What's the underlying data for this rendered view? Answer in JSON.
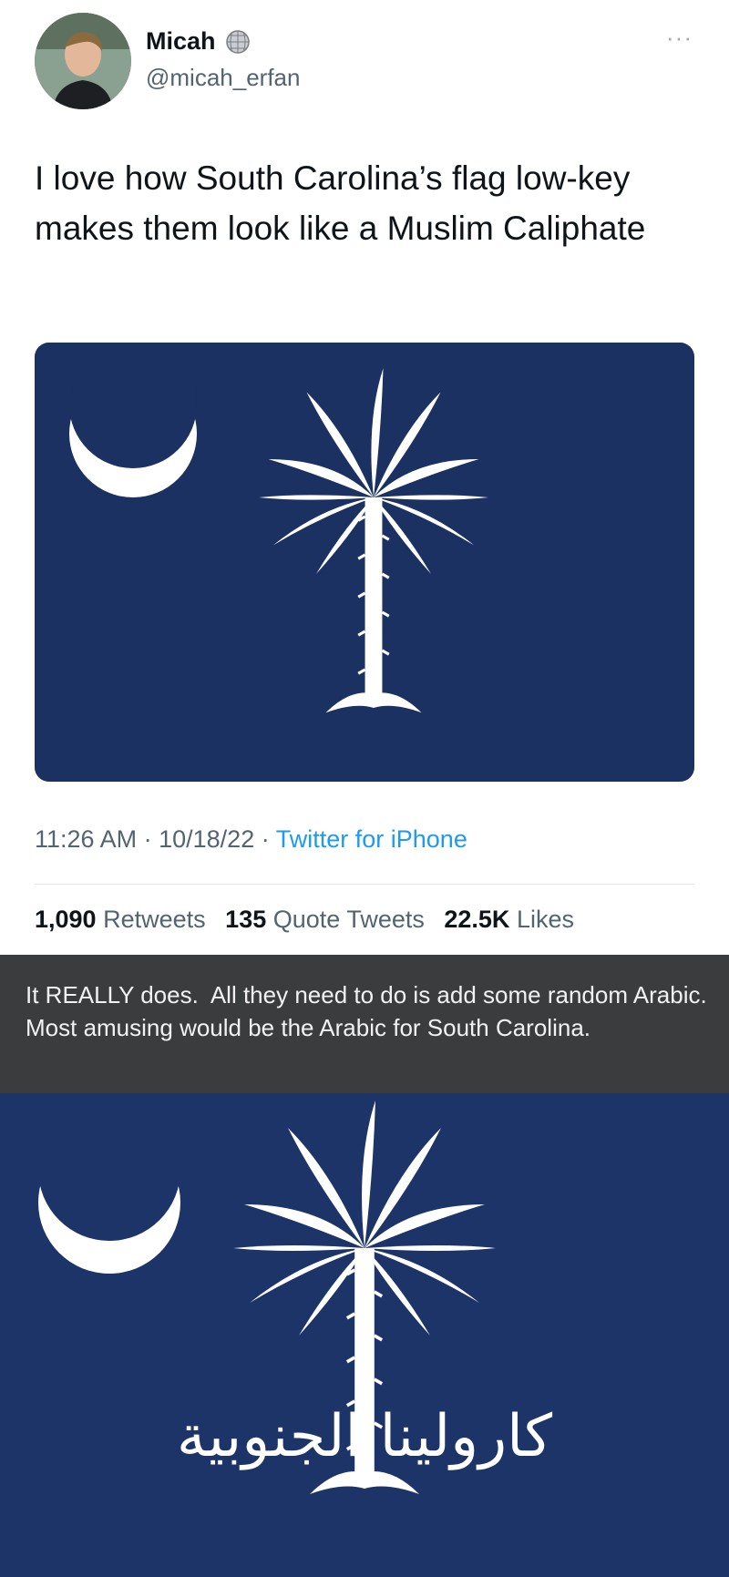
{
  "tweet": {
    "author_name": "Micah",
    "author_handle": "@micah_erfan",
    "name_badge_icon": "disco-ball-icon",
    "more_label": "···",
    "text": "I love how South Carolina’s flag low-key makes them look like a Muslim Caliphate",
    "time": "11:26 AM",
    "separator": "·",
    "date": "10/18/22",
    "source": "Twitter for iPhone",
    "stats": {
      "retweets_count": "1,090",
      "retweets_label": "Retweets",
      "quotes_count": "135",
      "quotes_label": "Quote Tweets",
      "likes_count": "22.5K",
      "likes_label": "Likes"
    },
    "media_icon": "south-carolina-flag"
  },
  "reply": {
    "text": "It REALLY does.  All they need to do is add some random Arabic. Most amusing would be the Arabic for South Carolina."
  },
  "flag_edit": {
    "arabic_text": "كارولينا الجنوبية",
    "icon": "south-carolina-flag"
  },
  "colors": {
    "flag_blue": "#1b3161",
    "link_blue": "#1d9bf0",
    "reply_bg": "#3b3c3e"
  }
}
